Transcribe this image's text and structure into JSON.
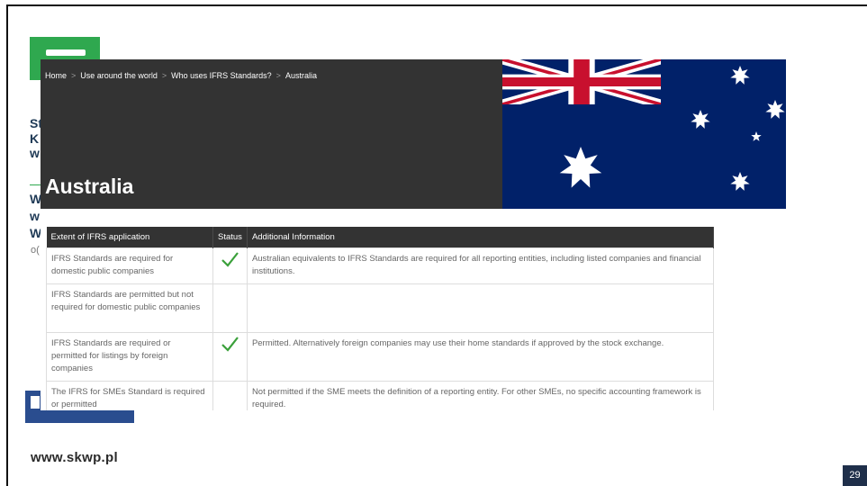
{
  "slide": {
    "url": "www.skwp.pl",
    "page_number": "29",
    "side_fragments": [
      "St",
      "K",
      "w",
      "W",
      "w",
      "W",
      "o("
    ]
  },
  "screenshot": {
    "breadcrumb": [
      "Home",
      "Use around the world",
      "Who uses IFRS Standards?",
      "Australia"
    ],
    "title": "Australia",
    "table": {
      "headers": [
        "Extent of IFRS application",
        "Status",
        "Additional Information"
      ],
      "rows": [
        {
          "extent": "IFRS Standards are required for domestic public companies",
          "status": "check",
          "info": "Australian equivalents to IFRS Standards are required for all reporting entities, including listed companies and financial institutions."
        },
        {
          "extent": "IFRS Standards are permitted but not required for domestic public companies",
          "status": "",
          "info": ""
        },
        {
          "extent": "IFRS Standards are required or permitted for listings by foreign companies",
          "status": "check",
          "info": "Permitted. Alternatively foreign companies may use their home standards if approved by the stock exchange."
        },
        {
          "extent": "The IFRS for SMEs Standard is required or permitted",
          "status": "",
          "info": "Not permitted if the SME meets the definition of a reporting entity. For other SMEs, no specific accounting framework is required."
        }
      ]
    }
  },
  "colors": {
    "hero_bg": "#333333",
    "flag_blue": "#012169",
    "flag_red": "#C8102E",
    "check_green": "#3aa03a",
    "brand_green": "#2fa84f"
  }
}
